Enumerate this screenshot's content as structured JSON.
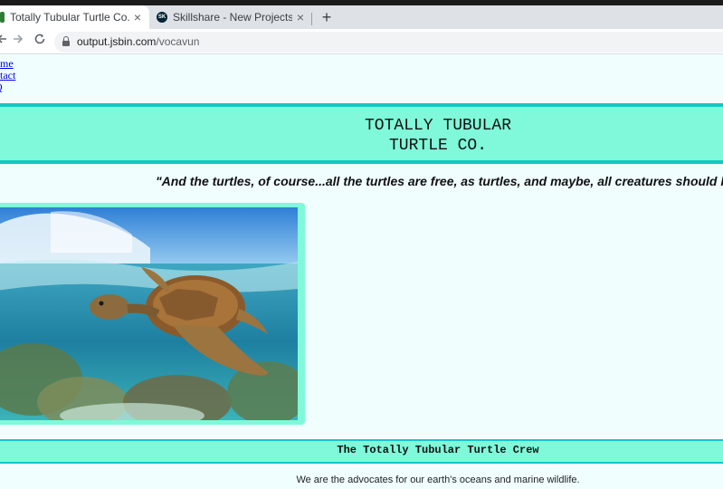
{
  "browser": {
    "tabs": [
      {
        "title": "Totally Tubular Turtle Co.",
        "active": true
      },
      {
        "title": "Skillshare - New Projects",
        "active": false,
        "favicon_text": "SK"
      }
    ],
    "close_symbol": "×",
    "new_tab_symbol": "+",
    "url_host": "output.jsbin.com",
    "url_path": "/vocavun",
    "icons": [
      "back-arrow-icon",
      "forward-arrow-icon",
      "reload-icon",
      "lock-icon",
      "close-icon",
      "plus-icon"
    ]
  },
  "page": {
    "nav": [
      {
        "label": "ome"
      },
      {
        "label": "ntact"
      },
      {
        "label": "Q"
      }
    ],
    "banner_line1": "TOTALLY TUBULAR",
    "banner_line2": "TURTLE CO.",
    "quote": "\"And the turtles, of course...all the turtles are free, as turtles, and maybe, all creatures should be.\"",
    "crew_heading": "The Totally Tubular Turtle Crew",
    "advocates_text": "We are the advocates for our earth's oceans and marine wildlife.",
    "colors": {
      "accent": "#7ff9d9",
      "border": "#16c6c8",
      "background": "#f0fefe",
      "link": "#0000ee"
    }
  }
}
